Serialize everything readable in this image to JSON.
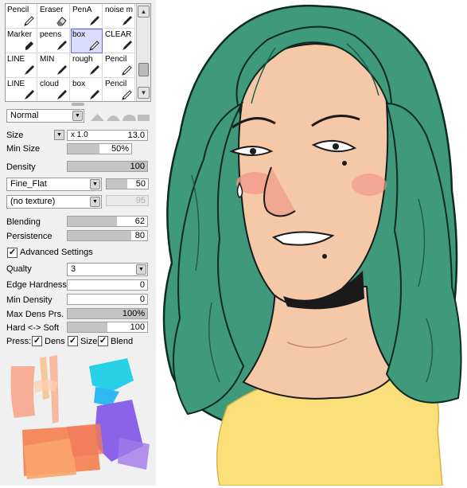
{
  "brushes": [
    {
      "label": "Pencil",
      "icon": "pencil-icon"
    },
    {
      "label": "Eraser",
      "icon": "eraser-icon"
    },
    {
      "label": "PenA",
      "icon": "pen-icon"
    },
    {
      "label": "noise m",
      "icon": "pen-icon"
    },
    {
      "label": "Marker",
      "icon": "marker-icon"
    },
    {
      "label": "peens",
      "icon": "pen-icon"
    },
    {
      "label": "box",
      "icon": "pencil-icon",
      "selected": true
    },
    {
      "label": "CLEAR",
      "icon": "pen-icon"
    },
    {
      "label": "LINE",
      "icon": "pen-icon"
    },
    {
      "label": "MIN",
      "icon": "pen-icon"
    },
    {
      "label": "rough",
      "icon": "pen-icon"
    },
    {
      "label": "Pencil",
      "icon": "pencil-icon"
    },
    {
      "label": "LINE",
      "icon": "pen-icon"
    },
    {
      "label": "cloud",
      "icon": "pen-icon"
    },
    {
      "label": "box",
      "icon": "pen-icon"
    },
    {
      "label": "Pencil",
      "icon": "pencil-icon"
    }
  ],
  "blend_mode": "Normal",
  "size": {
    "label": "Size",
    "multiplier": "x 1.0",
    "value": "13.0"
  },
  "min_size": {
    "label": "Min Size",
    "value": "50%",
    "level": 0.5
  },
  "density": {
    "label": "Density",
    "value": "100",
    "level": 1.0
  },
  "brush_shape": {
    "value": "Fine_Flat",
    "amount": "50",
    "level": 0.5
  },
  "texture": {
    "value": "(no texture)",
    "amount": "95",
    "level": 0.95
  },
  "blending": {
    "label": "Blending",
    "value": "62",
    "level": 0.62
  },
  "persistence": {
    "label": "Persistence",
    "value": "80",
    "level": 0.8
  },
  "advanced": {
    "label": "Advanced Settings",
    "checked": true
  },
  "quality": {
    "label": "Qualty",
    "value": "3"
  },
  "edge_hardness": {
    "label": "Edge Hardness",
    "value": "0",
    "level": 0
  },
  "min_density": {
    "label": "Min Density",
    "value": "0",
    "level": 0
  },
  "max_dens_prs": {
    "label": "Max Dens Prs.",
    "value": "100%",
    "level": 1.0
  },
  "hard_soft": {
    "label": "Hard <-> Soft",
    "value": "100",
    "level": 0.5
  },
  "press": {
    "label": "Press:",
    "dens": "Dens",
    "size": "Size",
    "blend": "Blend"
  },
  "colors": {
    "panel": "#f0f0f0",
    "selected": "#dcdcff",
    "hair": "#3f9a7c",
    "skin": "#f5c8a8",
    "shirt": "#fbe07a"
  }
}
